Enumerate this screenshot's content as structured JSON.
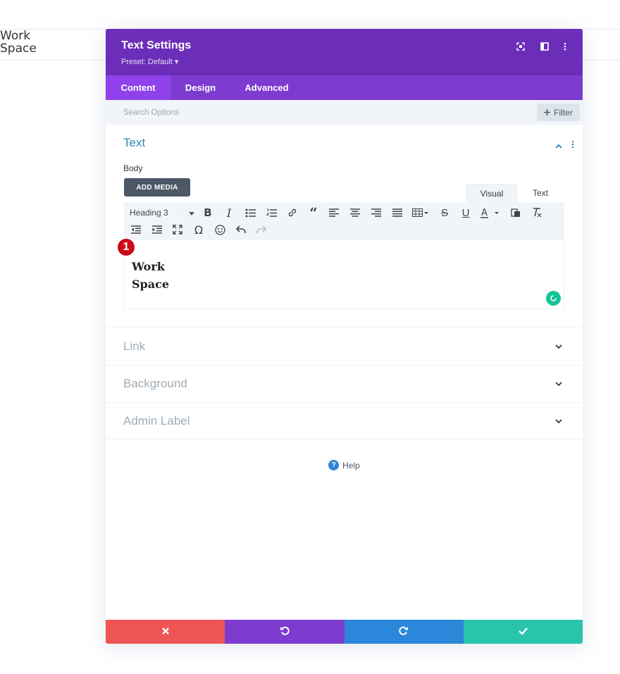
{
  "background": {
    "text_line1": "Work",
    "text_line2": "Space"
  },
  "modal": {
    "title": "Text Settings",
    "preset": "Preset: Default ▾",
    "header_icons": [
      "focus-icon",
      "split-view-icon",
      "more-vertical-icon"
    ],
    "tabs": [
      {
        "label": "Content",
        "active": true
      },
      {
        "label": "Design",
        "active": false
      },
      {
        "label": "Advanced",
        "active": false
      }
    ],
    "search": {
      "placeholder": "Search Options",
      "filter_label": "Filter"
    },
    "text_section": {
      "title": "Text",
      "body_label": "Body",
      "add_media_label": "ADD MEDIA",
      "editor_tabs": {
        "visual": "Visual",
        "text": "Text"
      },
      "heading_select": "Heading 3",
      "content_line1": "Work",
      "content_line2": "Space",
      "marker": "1"
    },
    "collapsed_sections": [
      "Link",
      "Background",
      "Admin Label"
    ],
    "help_label": "Help",
    "footer_colors": {
      "discard": "#ef5555",
      "undo": "#7e3bd0",
      "redo": "#2b87da",
      "save": "#29c4a9"
    }
  },
  "colors": {
    "header": "#6c2eb9",
    "tabs_bg": "#7e3bd0",
    "tab_active": "#8f42ec",
    "section_title": "#2e85b9"
  }
}
